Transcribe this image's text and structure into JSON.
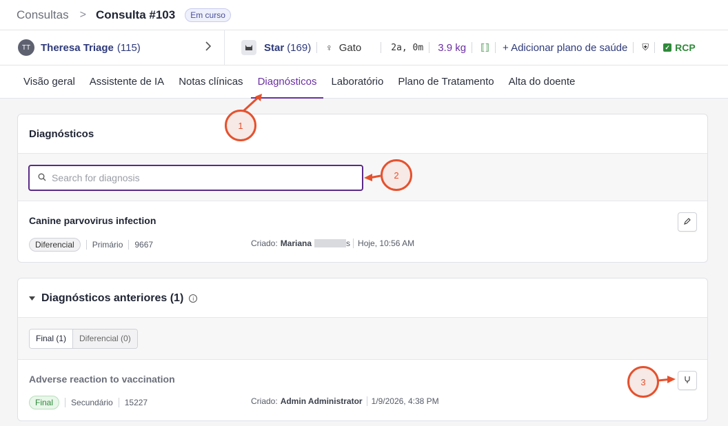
{
  "breadcrumb": {
    "parent": "Consultas",
    "separator": ">",
    "current": "Consulta #103",
    "status": "Em curso"
  },
  "owner": {
    "initials": "TT",
    "name": "Theresa Triage",
    "count": "(115)"
  },
  "pet": {
    "icon": "pet-avatar-icon",
    "name": "Star",
    "count": "(169)",
    "sex_icon": "♀",
    "species": "Gato",
    "age": "2a, 0m",
    "weight": "3.9 kg",
    "chip_icon": "⟦⟧",
    "add_plan": "+ Adicionar plano de saúde",
    "shield_icon": "⛨",
    "rcp": "RCP",
    "rcp_check": "✓"
  },
  "tabs": [
    {
      "label": "Visão geral"
    },
    {
      "label": "Assistente de IA"
    },
    {
      "label": "Notas clínicas"
    },
    {
      "label": "Diagnósticos"
    },
    {
      "label": "Laboratório"
    },
    {
      "label": "Plano de Tratamento"
    },
    {
      "label": "Alta do doente"
    }
  ],
  "diagnostics": {
    "title": "Diagnósticos",
    "search_placeholder": "Search for diagnosis",
    "current": {
      "name": "Canine parvovirus infection",
      "type": "Diferencial",
      "rank": "Primário",
      "code": "9667",
      "created_label": "Criado:",
      "created_by": "Mariana",
      "created_by_tail": "s",
      "created_at": "Hoje, 10:56 AM"
    }
  },
  "previous": {
    "title": "Diagnósticos anteriores (1)",
    "filters": {
      "final": "Final (1)",
      "differential": "Diferencial (0)"
    },
    "item": {
      "name": "Adverse reaction to vaccination",
      "type": "Final",
      "rank": "Secundário",
      "code": "15227",
      "created_label": "Criado:",
      "created_by": "Admin Administrator",
      "created_at": "1/9/2026, 4:38 PM"
    }
  },
  "annotations": [
    "1",
    "2",
    "3"
  ],
  "colors": {
    "accent": "#6b2fa3",
    "annotation": "#e5512d",
    "success": "#2f8a3a",
    "link": "#2e3a7a"
  }
}
